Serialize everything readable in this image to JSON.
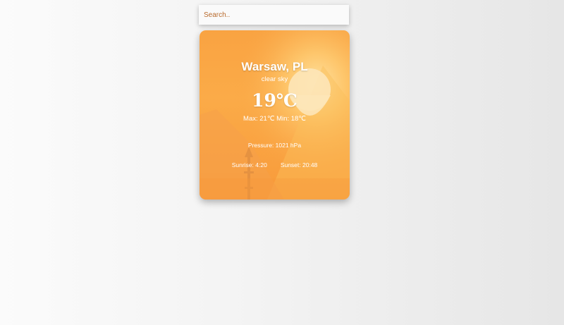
{
  "search": {
    "placeholder": "Search.."
  },
  "weather": {
    "city": "Warsaw, PL",
    "description": "clear sky",
    "temperature": "19℃",
    "minmax": "Max: 21℃ Min: 18℃",
    "pressure": "Pressure: 1021 hPa",
    "sunrise": "Sunrise: 4:20",
    "sunset": "Sunset: 20:48"
  },
  "colors": {
    "card_orange": "#f9a342",
    "sun_glow": "#fde2b0",
    "text": "#ffffff"
  },
  "illustration": {
    "icons": [
      "sun-icon",
      "mountain-left-icon",
      "mountain-right-icon",
      "tree-icon"
    ]
  }
}
